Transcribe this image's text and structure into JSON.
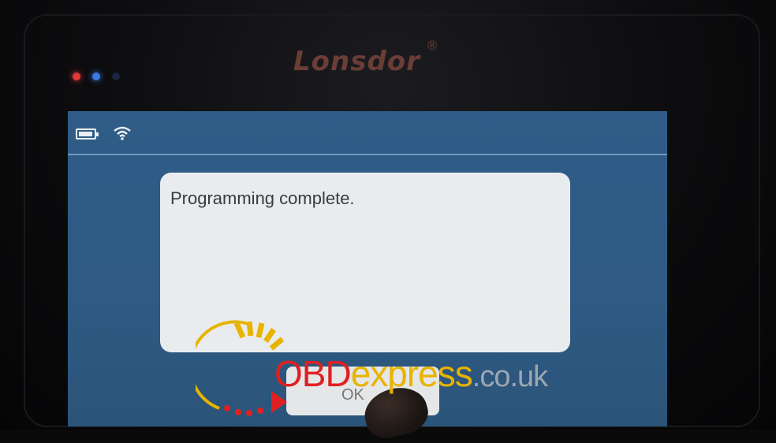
{
  "device": {
    "brand": "Lonsdor",
    "registered_mark": "®"
  },
  "status_bar": {
    "icons": [
      "battery-icon",
      "wifi-icon"
    ]
  },
  "dialog": {
    "message": "Programming complete.",
    "ok_label": "OK"
  },
  "watermark": {
    "part1": "OBD",
    "part2": "express",
    "part3": ".co.uk"
  },
  "colors": {
    "screen_bg": "#2f5d87",
    "dialog_bg": "#e9ecee",
    "watermark_red": "#e02020",
    "watermark_yellow": "#e8b400"
  }
}
